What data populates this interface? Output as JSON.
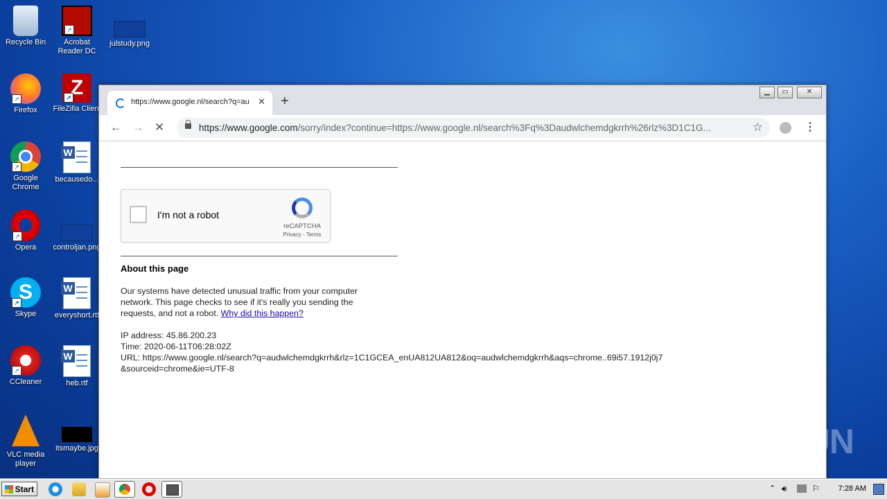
{
  "desktop": {
    "icons": [
      {
        "label": "Recycle Bin"
      },
      {
        "label": "Acrobat Reader DC"
      },
      {
        "label": "julstudy.png"
      },
      {
        "label": "Firefox"
      },
      {
        "label": "FileZilla Client"
      },
      {
        "label": "Google Chrome"
      },
      {
        "label": "becausedo..."
      },
      {
        "label": "Opera"
      },
      {
        "label": "controljan.png"
      },
      {
        "label": "Skype"
      },
      {
        "label": "everyshort.rtf"
      },
      {
        "label": "CCleaner"
      },
      {
        "label": "heb.rtf"
      },
      {
        "label": "VLC media player"
      },
      {
        "label": "itsmaybe.jpg"
      }
    ],
    "watermark": "ANY RUN"
  },
  "browser": {
    "tab_title": "https://www.google.nl/search?q=au",
    "tab_close": "✕",
    "new_tab": "+",
    "url_host": "https://www.google.com",
    "url_rest": "/sorry/index?continue=https://www.google.nl/search%3Fq%3Daudwlchemdgkrrh%26rlz%3D1C1G...",
    "back": "←",
    "forward": "→",
    "stop": "✕",
    "star": "☆",
    "menu": "⋮",
    "window_min": "▁",
    "window_max": "▭",
    "window_close": "✕"
  },
  "page": {
    "captcha_label": "I'm not a robot",
    "captcha_brand": "reCAPTCHA",
    "captcha_terms": "Privacy - Terms",
    "about_title": "About this page",
    "about_text": "Our systems have detected unusual traffic from your computer network. This page checks to see if it's really you sending the requests, and not a robot.",
    "about_link": "Why did this happen?",
    "ip_line": "IP address: 45.86.200.23",
    "time_line": "Time: 2020-06-11T06:28:02Z",
    "url_line": "URL: https://www.google.nl/search?q=audwlchemdgkrrh&rlz=1C1GCEA_enUA812UA812&oq=audwlchemdgkrrh&aqs=chrome..69i57.1912j0j7&sourceid=chrome&ie=UTF-8"
  },
  "taskbar": {
    "start_label": "Start",
    "clock": "7:28 AM"
  }
}
